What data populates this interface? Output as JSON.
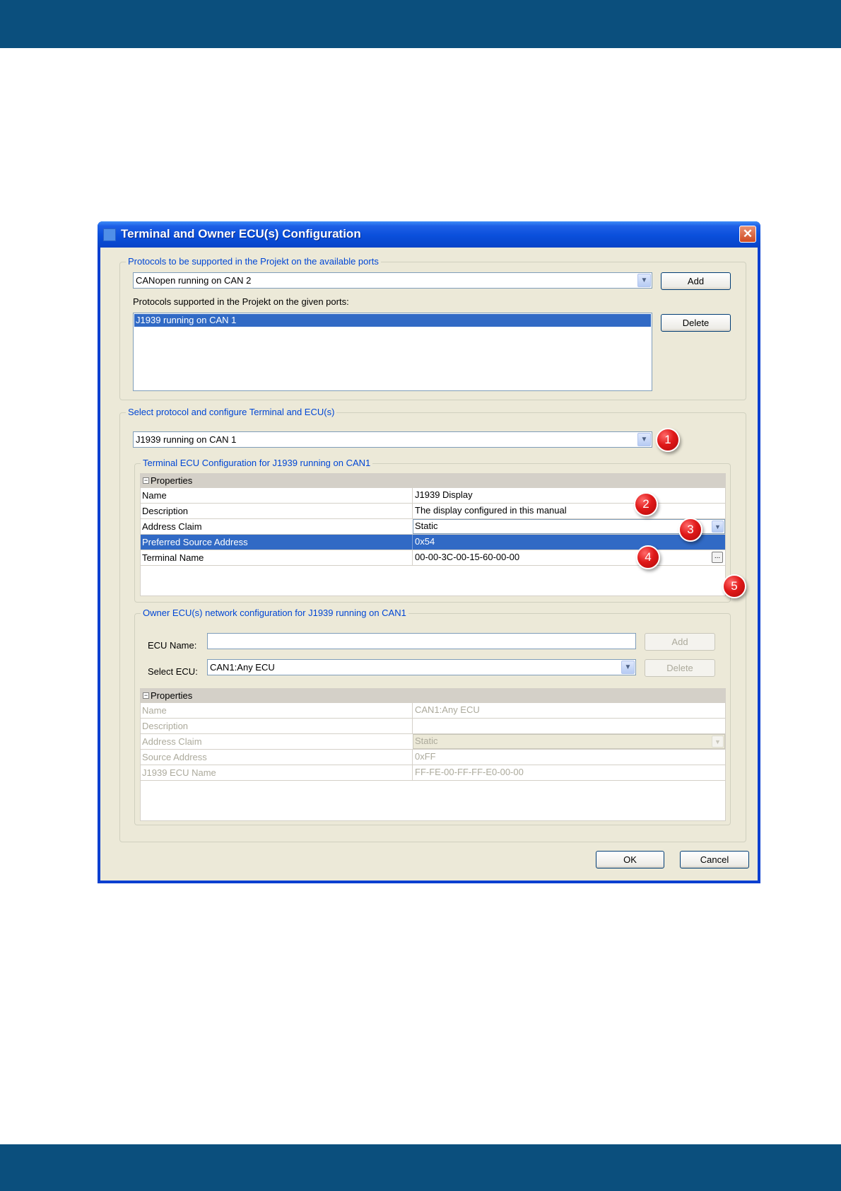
{
  "dialog": {
    "title": "Terminal and Owner ECU(s) Configuration",
    "close_glyph": "✕"
  },
  "protocols_group": {
    "title": "Protocols to be supported in the Projekt on the available ports",
    "available_protocol": "CANopen running on CAN 2",
    "add_label": "Add",
    "supported_label": "Protocols supported in the Projekt on the given ports:",
    "supported_items": [
      "J1939 running on CAN 1"
    ],
    "delete_label": "Delete"
  },
  "select_group": {
    "title": "Select protocol and configure Terminal and ECU(s)",
    "selected_protocol": "J1939 running on CAN 1"
  },
  "terminal_group": {
    "title": "Terminal ECU Configuration for J1939 running on CAN1",
    "properties_header": "Properties",
    "rows": [
      {
        "key": "Name",
        "value": "J1939 Display"
      },
      {
        "key": "Description",
        "value": "The display configured in this manual"
      },
      {
        "key": "Address Claim",
        "value": "Static"
      },
      {
        "key": "Preferred Source Address",
        "value": "0x54"
      },
      {
        "key": "Terminal Name",
        "value": "00-00-3C-00-15-60-00-00"
      }
    ],
    "ellipsis": "..."
  },
  "owner_group": {
    "title": "Owner ECU(s) network configuration  for J1939 running on CAN1",
    "ecu_name_label": "ECU Name:",
    "ecu_name_value": "",
    "add_label": "Add",
    "select_ecu_label": "Select ECU:",
    "selected_ecu": "CAN1:Any ECU",
    "delete_label": "Delete",
    "properties_header": "Properties",
    "rows": [
      {
        "key": "Name",
        "value": "CAN1:Any ECU"
      },
      {
        "key": "Description",
        "value": ""
      },
      {
        "key": "Address Claim",
        "value": "Static"
      },
      {
        "key": "Source Address",
        "value": "0xFF"
      },
      {
        "key": "J1939 ECU Name",
        "value": "FF-FE-00-FF-FF-E0-00-00"
      }
    ]
  },
  "footer": {
    "ok_label": "OK",
    "cancel_label": "Cancel"
  },
  "callouts": [
    "1",
    "2",
    "3",
    "4",
    "5"
  ],
  "colors": {
    "band": "#0b4f7d",
    "title_bar": "#0a4fdb",
    "group_title": "#0046d5",
    "selection": "#316ac5",
    "callout": "#e01919"
  }
}
